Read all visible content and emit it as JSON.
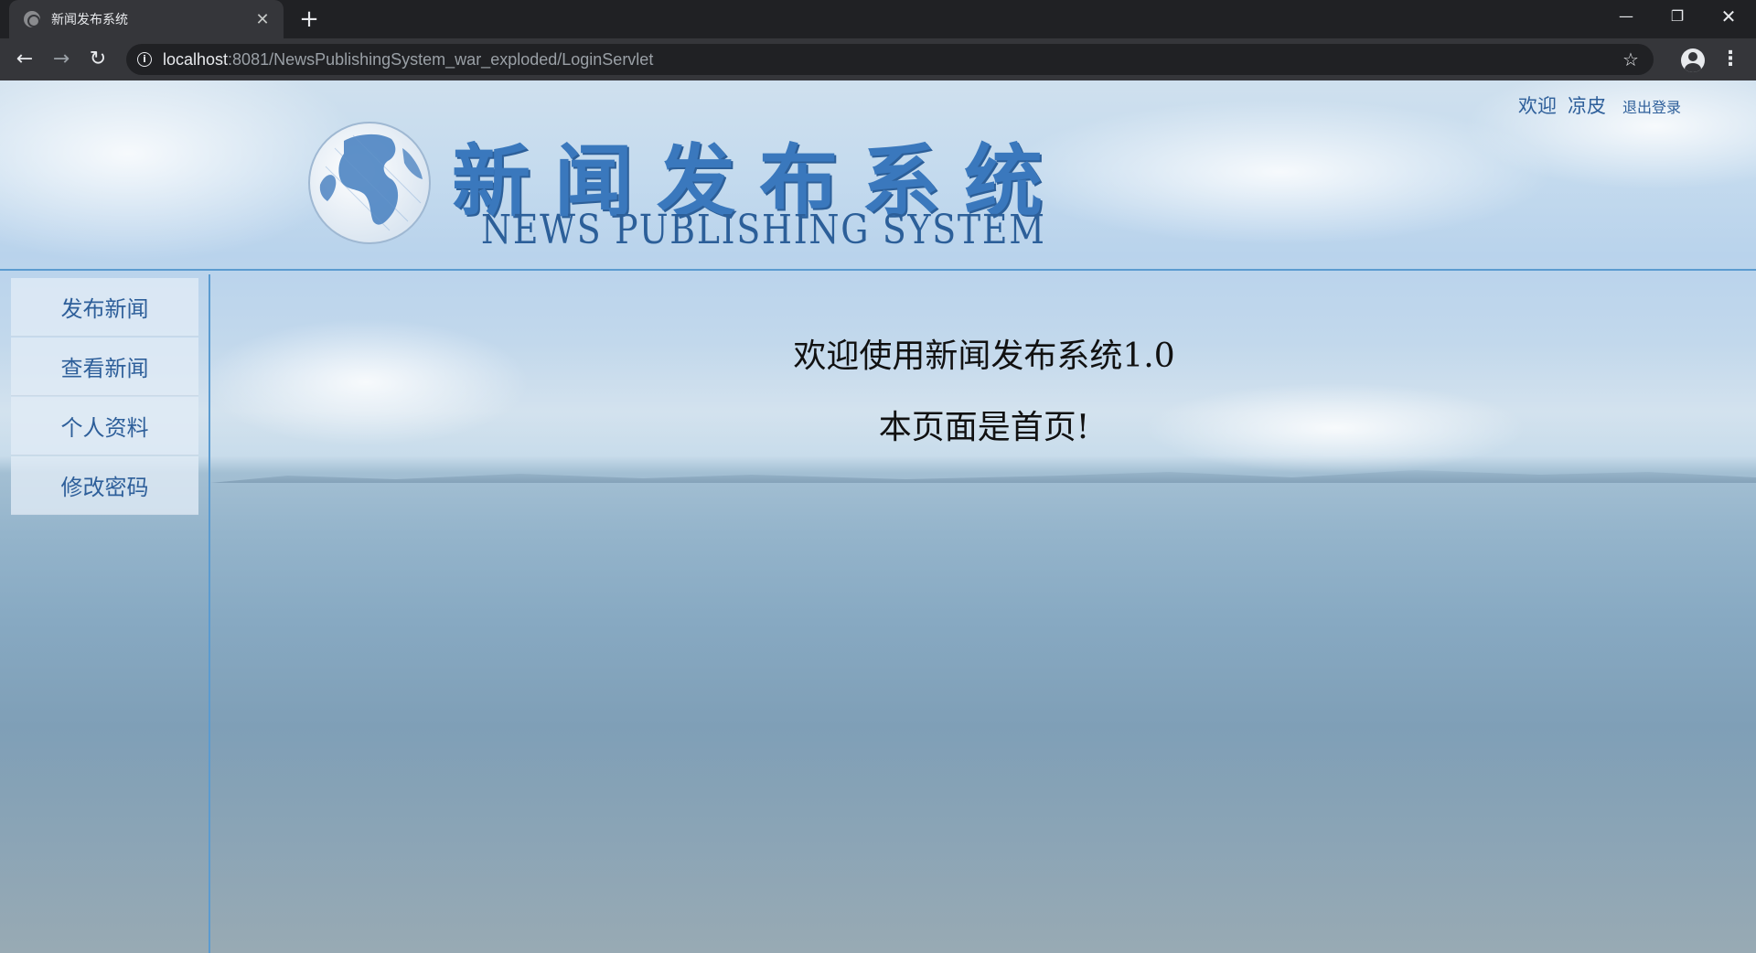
{
  "browser": {
    "tab_title": "新闻发布系统",
    "tab_close": "✕",
    "new_tab": "+",
    "url_host": "localhost",
    "url_rest": ":8081/NewsPublishingSystem_war_exploded/LoginServlet",
    "window_minimize": "—",
    "window_restore": "❐",
    "window_close": "✕"
  },
  "header": {
    "logo_cn": "新闻发布系统",
    "logo_en": "NEWS PUBLISHING SYSTEM",
    "welcome": "欢迎",
    "username": "凉皮",
    "logout": "退出登录"
  },
  "sidebar": {
    "items": [
      {
        "label": "发布新闻"
      },
      {
        "label": "查看新闻"
      },
      {
        "label": "个人资料"
      },
      {
        "label": "修改密码"
      }
    ]
  },
  "main": {
    "welcome_text": "欢迎使用新闻发布系统1.0",
    "home_text": "本页面是首页!"
  },
  "colors": {
    "brand_blue": "#3a78bd",
    "border_blue": "#5b9bd0",
    "link_blue": "#2e5f9a"
  }
}
